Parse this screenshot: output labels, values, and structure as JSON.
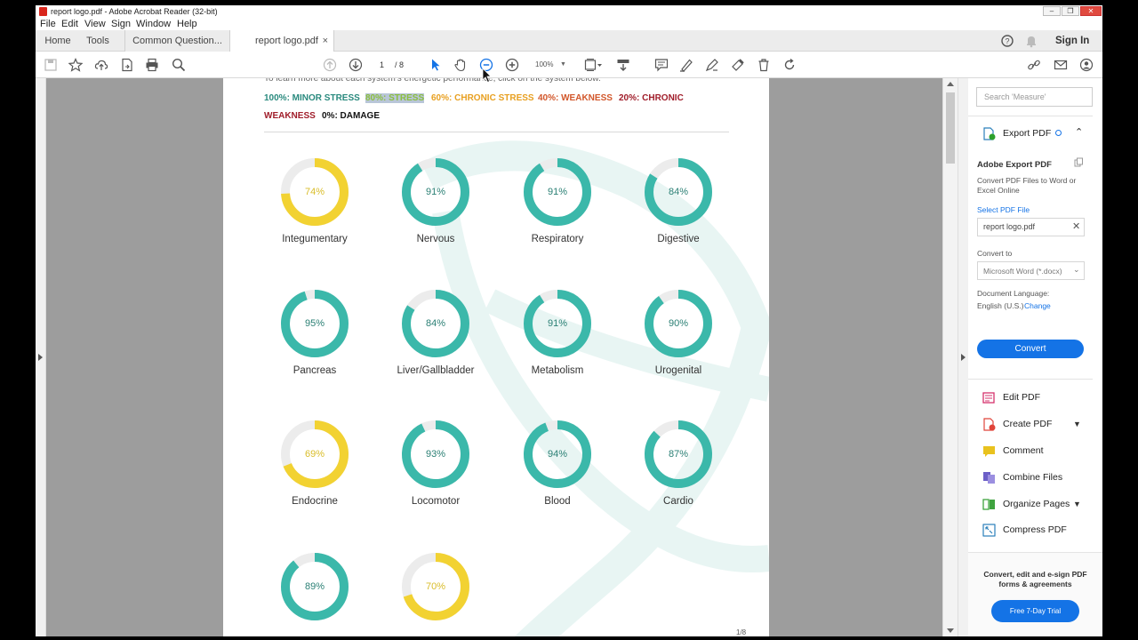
{
  "window": {
    "title": "report logo.pdf - Adobe Acrobat Reader (32-bit)"
  },
  "menu": [
    "File",
    "Edit",
    "View",
    "Sign",
    "Window",
    "Help"
  ],
  "tabs": {
    "home": "Home",
    "tools": "Tools",
    "doc1": "Common Question...",
    "doc2": "report logo.pdf",
    "close": "×",
    "signin": "Sign In"
  },
  "toolbar": {
    "page_current": "1",
    "page_total": "/ 8",
    "zoom": "100%"
  },
  "legend": {
    "minor": "100%: MINOR STRESS",
    "stress": "80%: STRESS",
    "chronic": "60%: CHRONIC STRESS",
    "weakness": "40%: WEAKNESS",
    "chronic_weak_1": "20%: CHRONIC",
    "chronic_weak_2": "WEAKNESS",
    "damage": "0%: DAMAGE"
  },
  "colors": {
    "teal": "#3bb8aa",
    "yellow": "#f2d232",
    "track": "#ececec",
    "minor": "#2a8a7e",
    "stress": "#8cbf3f",
    "chronic": "#e8a021",
    "weakness": "#d2572b",
    "chronic_weak": "#a01d2a",
    "damage": "#111111",
    "blue": "#1473e6"
  },
  "gauges": [
    {
      "label": "Integumentary",
      "value": "74%",
      "pct": 74,
      "color": "yellow"
    },
    {
      "label": "Nervous",
      "value": "91%",
      "pct": 91,
      "color": "teal"
    },
    {
      "label": "Respiratory",
      "value": "91%",
      "pct": 91,
      "color": "teal"
    },
    {
      "label": "Digestive",
      "value": "84%",
      "pct": 84,
      "color": "teal"
    },
    {
      "label": "Pancreas",
      "value": "95%",
      "pct": 95,
      "color": "teal"
    },
    {
      "label": "Liver/Gallbladder",
      "value": "84%",
      "pct": 84,
      "color": "teal"
    },
    {
      "label": "Metabolism",
      "value": "91%",
      "pct": 91,
      "color": "teal"
    },
    {
      "label": "Urogenital",
      "value": "90%",
      "pct": 90,
      "color": "teal"
    },
    {
      "label": "Endocrine",
      "value": "69%",
      "pct": 69,
      "color": "yellow"
    },
    {
      "label": "Locomotor",
      "value": "93%",
      "pct": 93,
      "color": "teal"
    },
    {
      "label": "Blood",
      "value": "94%",
      "pct": 94,
      "color": "teal"
    },
    {
      "label": "Cardio",
      "value": "87%",
      "pct": 87,
      "color": "teal"
    },
    {
      "label": "",
      "value": "89%",
      "pct": 89,
      "color": "teal"
    },
    {
      "label": "",
      "value": "70%",
      "pct": 70,
      "color": "yellow"
    }
  ],
  "page_footer": "1/8",
  "right_pane": {
    "search_placeholder": "Search 'Measure'",
    "export_title": "Export PDF",
    "adobe_export": "Adobe Export PDF",
    "desc": "Convert PDF Files to Word or Excel Online",
    "select_file": "Select PDF File",
    "file_name": "report logo.pdf",
    "convert_to": "Convert to",
    "format": "Microsoft Word (*.docx)",
    "doc_lang_label": "Document Language:",
    "doc_lang": "English (U.S.)",
    "change": "Change",
    "convert_btn": "Convert",
    "tools": [
      "Edit PDF",
      "Create PDF",
      "Comment",
      "Combine Files",
      "Organize Pages",
      "Compress PDF"
    ],
    "promo": "Convert, edit and e-sign PDF forms & agreements",
    "trial_btn": "Free 7-Day Trial"
  }
}
